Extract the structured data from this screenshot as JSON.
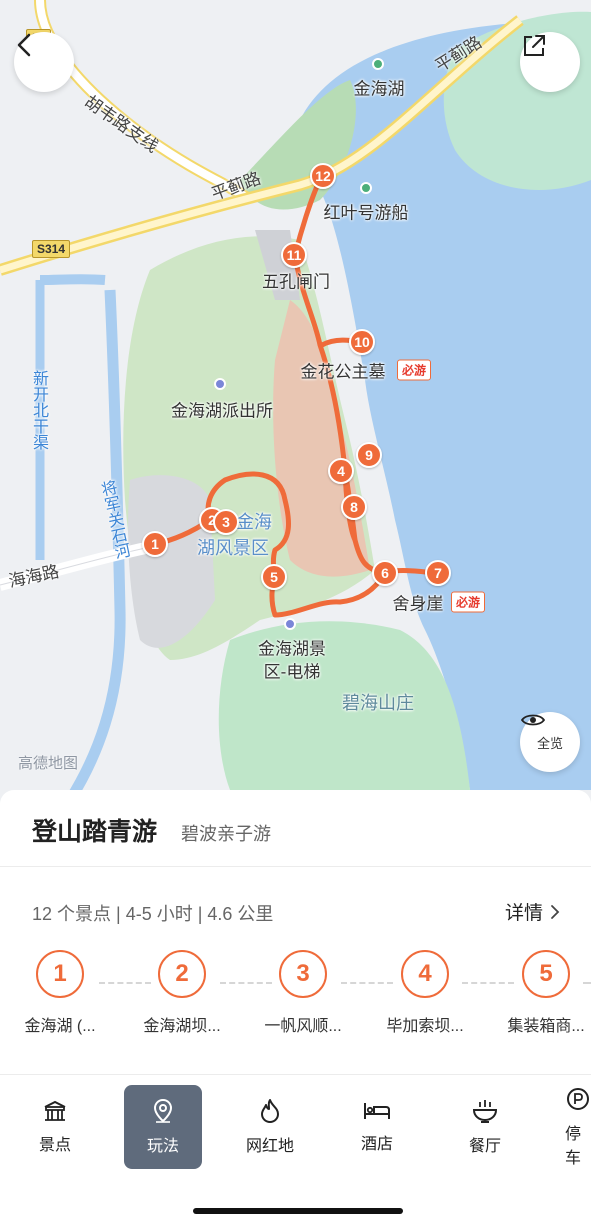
{
  "map": {
    "labels": {
      "jinhaihu_top": "金海湖",
      "hongye": "红叶号游船",
      "wukong": "五孔闸门",
      "jinhua": "金花公主墓",
      "police": "金海湖派出所",
      "scenic_area_1": "北京金海",
      "scenic_area_2": "湖风景区",
      "elevator_1": "金海湖景",
      "elevator_2": "区-电梯",
      "sheshenya": "舍身崖",
      "bihai": "碧海山庄",
      "canal": "新开北干渠",
      "river": "将军关石河"
    },
    "roads": {
      "huwei": "胡韦路支线",
      "pingji_top": "平蓟路",
      "pingji_mid": "平蓟路",
      "haihai": "海海路",
      "shield": "S314",
      "badge": "S1"
    },
    "must_visit": "必游",
    "stops": [
      "1",
      "2",
      "3",
      "4",
      "5",
      "6",
      "7",
      "8",
      "9",
      "10",
      "11",
      "12"
    ],
    "watermark": "高德地图",
    "overview_label": "全览",
    "colors": {
      "route": "#ef6b3a",
      "water": "#a9cdf0",
      "park": "#cfe6c6"
    }
  },
  "sheet": {
    "title": "登山踏青游",
    "subtitle": "碧波亲子游",
    "summary": "12 个景点 | 4-5 小时 | 4.6 公里",
    "details": "详情",
    "stops": [
      {
        "num": "1",
        "name": "金海湖 (..."
      },
      {
        "num": "2",
        "name": "金海湖坝..."
      },
      {
        "num": "3",
        "name": "一帆风顺..."
      },
      {
        "num": "4",
        "name": "毕加索坝..."
      },
      {
        "num": "5",
        "name": "集装箱商..."
      }
    ]
  },
  "tabs": [
    {
      "label": "景点",
      "icon": "gate-icon"
    },
    {
      "label": "玩法",
      "icon": "location-pin-icon"
    },
    {
      "label": "网红地",
      "icon": "flame-icon"
    },
    {
      "label": "酒店",
      "icon": "bed-icon"
    },
    {
      "label": "餐厅",
      "icon": "bowl-icon"
    },
    {
      "label": "停车",
      "icon": "parking-icon"
    }
  ]
}
